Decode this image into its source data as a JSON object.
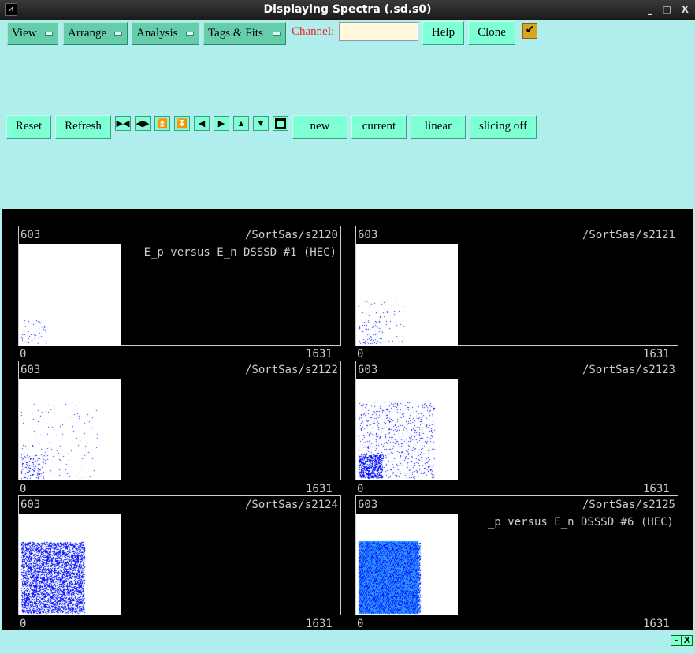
{
  "window": {
    "title": "Displaying Spectra (.sd.s0)",
    "min": "_",
    "max": "□",
    "close": "X"
  },
  "menus": [
    "View",
    "Arrange",
    "Analysis",
    "Tags & Fits"
  ],
  "channel": {
    "label": "Channel:",
    "value": ""
  },
  "buttons": {
    "help": "Help",
    "clone": "Clone",
    "reset": "Reset",
    "refresh": "Refresh",
    "new": "new",
    "current": "current",
    "linear": "linear",
    "slicing": "slicing off"
  },
  "checkbox": {
    "checked": true,
    "mark": "✔"
  },
  "panels": [
    {
      "ymax": "603",
      "name": "/SortSas/s2120",
      "title": "E_p versus E_n DSSSD #1 (HEC)",
      "xmin": "0",
      "xmax": "1631"
    },
    {
      "ymax": "603",
      "name": "/SortSas/s2121",
      "title": "",
      "xmin": "0",
      "xmax": "1631"
    },
    {
      "ymax": "603",
      "name": "/SortSas/s2122",
      "title": "",
      "xmin": "0",
      "xmax": "1631"
    },
    {
      "ymax": "603",
      "name": "/SortSas/s2123",
      "title": "",
      "xmin": "0",
      "xmax": "1631"
    },
    {
      "ymax": "603",
      "name": "/SortSas/s2124",
      "title": "",
      "xmin": "0",
      "xmax": "1631"
    },
    {
      "ymax": "603",
      "name": "/SortSas/s2125",
      "title": "_p versus E_n DSSSD #6 (HEC)",
      "xmin": "0",
      "xmax": "1631"
    }
  ],
  "bottom": {
    "min": "-",
    "close": "X"
  }
}
